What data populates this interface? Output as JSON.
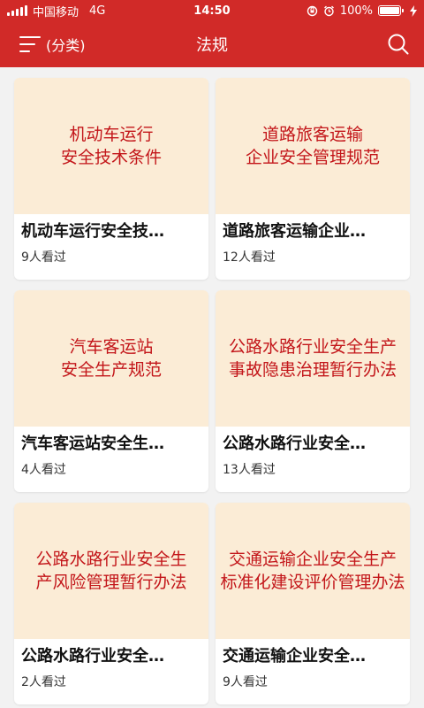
{
  "status_bar": {
    "carrier": "中国移动",
    "network": "4G",
    "time": "14:50",
    "battery_text": "100%"
  },
  "nav": {
    "category_label": "(分类)",
    "title": "法规"
  },
  "colors": {
    "brand_red": "#d12a28",
    "cover_bg": "#fbecd6",
    "cover_text": "#c3161a"
  },
  "cards": [
    {
      "cover_line1": "机动车运行",
      "cover_line2": "安全技术条件",
      "title": "机动车运行安全技…",
      "views": "9人看过"
    },
    {
      "cover_line1": "道路旅客运输",
      "cover_line2": "企业安全管理规范",
      "title": "道路旅客运输企业…",
      "views": "12人看过"
    },
    {
      "cover_line1": "汽车客运站",
      "cover_line2": "安全生产规范",
      "title": "汽车客运站安全生…",
      "views": "4人看过"
    },
    {
      "cover_line1": "公路水路行业安全生产",
      "cover_line2": "事故隐患治理暂行办法",
      "title": "公路水路行业安全…",
      "views": "13人看过"
    },
    {
      "cover_line1": "公路水路行业安全生",
      "cover_line2": "产风险管理暂行办法",
      "title": "公路水路行业安全…",
      "views": "2人看过"
    },
    {
      "cover_line1": "交通运输企业安全生产",
      "cover_line2": "标准化建设评价管理办法",
      "title": "交通运输企业安全…",
      "views": "9人看过"
    }
  ]
}
